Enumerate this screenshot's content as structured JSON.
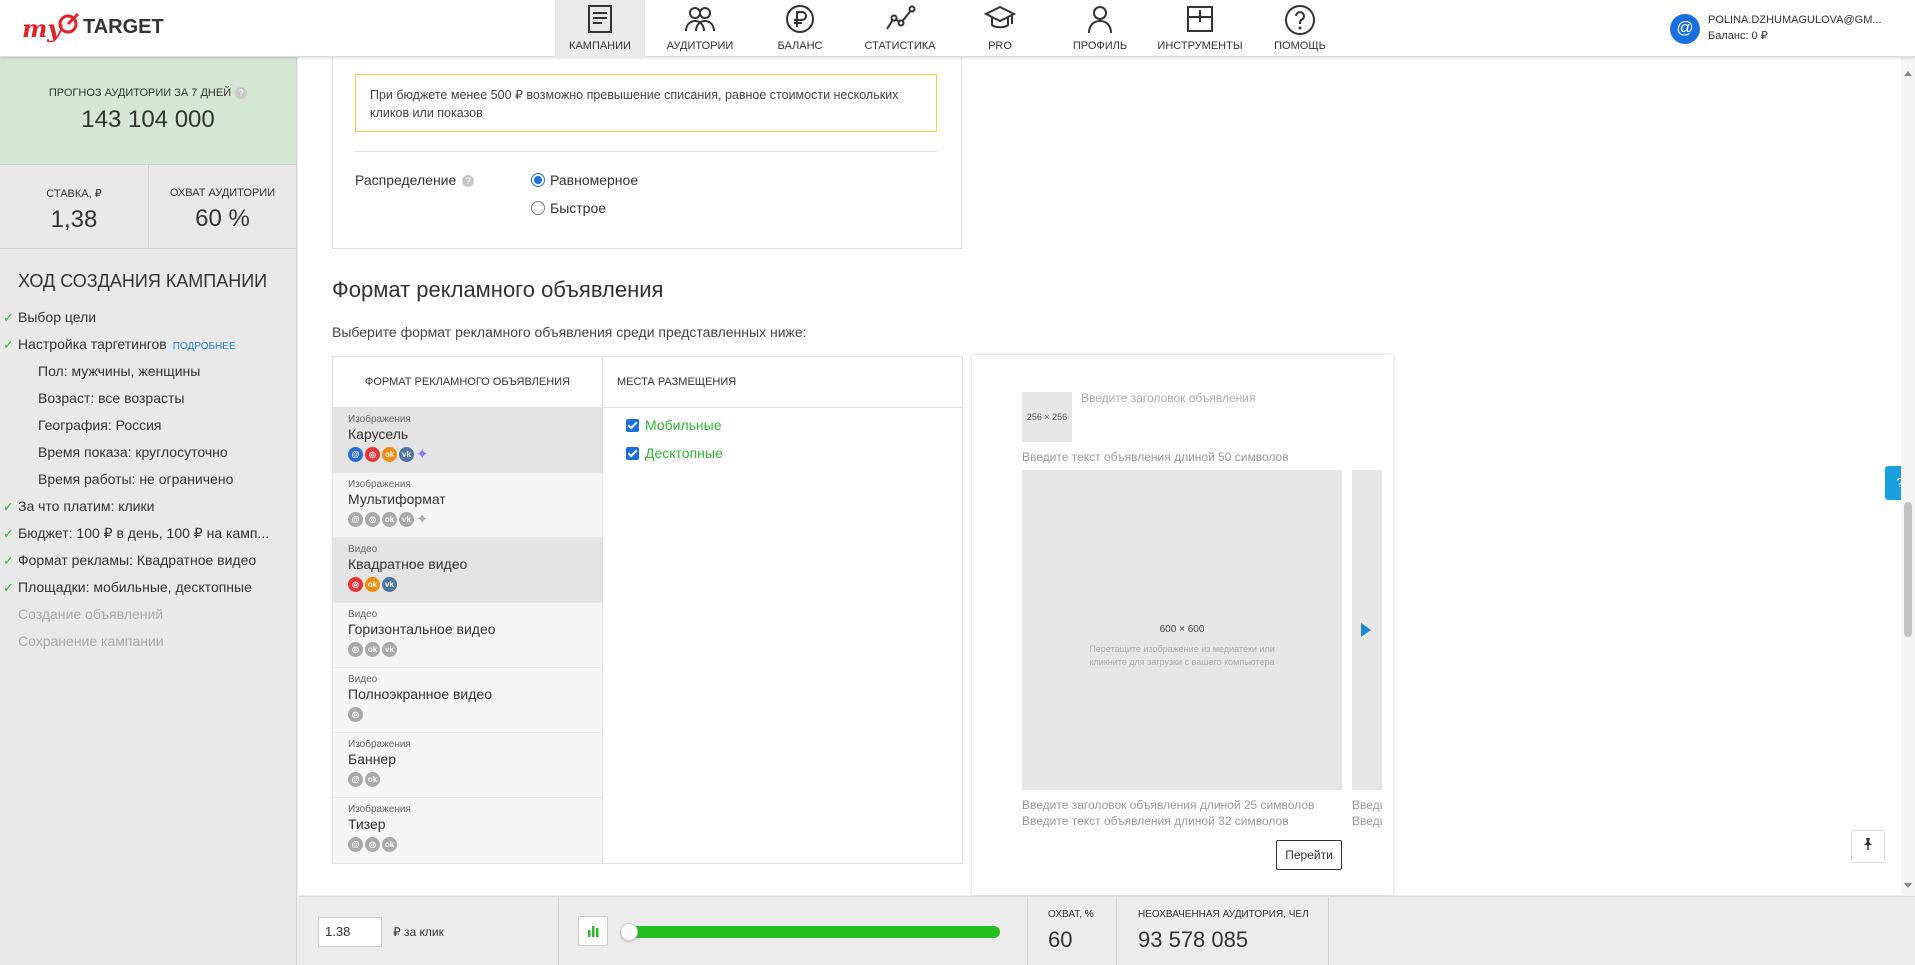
{
  "header": {
    "logo_my": "my",
    "logo_target": "TARGET",
    "nav": [
      {
        "label": "Кампании",
        "icon": "campaigns-icon",
        "active": true
      },
      {
        "label": "Аудитории",
        "icon": "audiences-icon"
      },
      {
        "label": "Баланс",
        "icon": "ruble-icon"
      },
      {
        "label": "Статистика",
        "icon": "stats-icon"
      },
      {
        "label": "PRO",
        "icon": "graduation-cap-icon"
      },
      {
        "label": "Профиль",
        "icon": "profile-icon"
      },
      {
        "label": "Инструменты",
        "icon": "tools-icon"
      },
      {
        "label": "Помощь",
        "icon": "help-icon"
      }
    ],
    "user": {
      "avatar": "@",
      "email": "POLINA.DZHUMAGULOVA@GM...",
      "balance": "Баланс: 0 ₽"
    }
  },
  "sidebar": {
    "forecast_label": "Прогноз аудитории за 7 дней",
    "forecast_help": "?",
    "forecast_value": "143 104 000",
    "bid_label": "Ставка, ₽",
    "bid_value": "1,38",
    "reach_label": "Охват аудитории",
    "reach_value": "60 %",
    "progress_title": "Ход создания кампании",
    "steps": [
      {
        "text": "Выбор цели",
        "done": true
      },
      {
        "text": "Настройка таргетингов",
        "done": true,
        "more": "подробнее"
      },
      {
        "text": "Пол: мужчины, женщины",
        "sub": true
      },
      {
        "text": "Возраст: все возрасты",
        "sub": true
      },
      {
        "text": "География: Россия",
        "sub": true
      },
      {
        "text": "Время показа: круглосуточно",
        "sub": true
      },
      {
        "text": "Время работы: не ограничено",
        "sub": true
      },
      {
        "text": "За что платим: клики",
        "done": true
      },
      {
        "text": "Бюджет: 100 ₽ в день, 100 ₽ на камп...",
        "done": true
      },
      {
        "text": "Формат рекламы: Квадратное видео",
        "done": true
      },
      {
        "text": "Площадки: мобильные, десктопные",
        "done": true
      },
      {
        "text": "Создание объявлений",
        "muted": true
      },
      {
        "text": "Сохранение кампании",
        "muted": true
      }
    ]
  },
  "budget": {
    "warning": "При бюджете менее 500 ₽ возможно превышение списания, равное стоимости нескольких кликов или показов",
    "distribution_label": "Распределение",
    "distribution_help": "?",
    "options": [
      {
        "label": "Равномерное",
        "checked": true
      },
      {
        "label": "Быстрое",
        "checked": false
      }
    ]
  },
  "format": {
    "title": "Формат рекламного объявления",
    "description": "Выберите формат рекламного объявления среди представленных ниже:",
    "list_header": "Формат рекламного объявления",
    "places_header": "Места размещения",
    "items": [
      {
        "category": "Изображения",
        "name": "Карусель",
        "selected": true,
        "icons": [
          "mm",
          "tg",
          "ok",
          "vk"
        ],
        "sparkle": "color"
      },
      {
        "category": "Изображения",
        "name": "Мультиформат",
        "icons": [
          "g",
          "g",
          "g",
          "g"
        ],
        "sparkle": "gray"
      },
      {
        "category": "Видео",
        "name": "Квадратное видео",
        "selected": true,
        "icons": [
          "tg",
          "ok",
          "vk"
        ]
      },
      {
        "category": "Видео",
        "name": "Горизонтальное видео",
        "icons": [
          "g",
          "g",
          "g"
        ]
      },
      {
        "category": "Видео",
        "name": "Полноэкранное видео",
        "icons": [
          "g"
        ]
      },
      {
        "category": "Изображения",
        "name": "Баннер",
        "icons": [
          "g",
          "g"
        ]
      },
      {
        "category": "Изображения",
        "name": "Тизер",
        "icons": [
          "g",
          "g",
          "g"
        ]
      }
    ],
    "places": [
      {
        "label": "Мобильные",
        "checked": true
      },
      {
        "label": "Десктопные",
        "checked": true
      }
    ]
  },
  "preview": {
    "thumb_size": "256 × 256",
    "headline_placeholder": "Введите заголовок объявления",
    "text_placeholder": "Введите текст объявления длиной 50 символов",
    "image_size": "600 × 600",
    "image_hint": "Перетащите изображение из медиатеки или кликните для загрузки с вашего компьютера",
    "title25": "Введите заголовок объявления длиной 25 символов",
    "text32": "Введите текст объявления длиной 32 символов",
    "title25_cut": "Введите заголовок",
    "text32_cut": "Введите текст",
    "go_button": "Перейти"
  },
  "widgets": {
    "help_tab": "?",
    "pin": "📌"
  },
  "bottom": {
    "bid_value": "1.38",
    "bid_unit": "₽ за клик",
    "slider_fill_pct": 100,
    "coverage_label": "Охват, %",
    "coverage_value": "60",
    "uncovered_label": "Неохваченная аудитория, чел",
    "uncovered_value": "93 578 085"
  }
}
